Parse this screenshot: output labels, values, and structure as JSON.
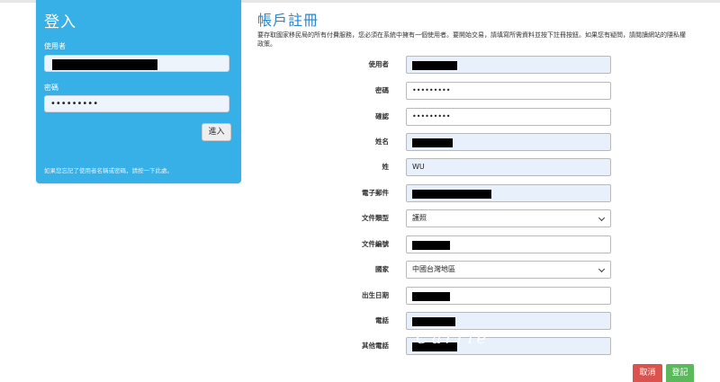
{
  "login": {
    "title": "登入",
    "username_label": "使用者",
    "password_label": "密碼",
    "password_value": "•••••••••",
    "submit_label": "進入",
    "forgot_note": "如果您忘記了使用者名稱或密碼，請按一下此處。"
  },
  "register": {
    "title": "帳戶註冊",
    "description": "要存取國家移民局的所有付費服務，您必須在系統中擁有一個使用者。要開始交易，請填寫所需資料並按下註冊按鈕。如果您有疑問，請閱讀網站的隱私權政策。",
    "fields": [
      {
        "label": "使用者",
        "value": ""
      },
      {
        "label": "密碼",
        "value": "•••••••••"
      },
      {
        "label": "確認",
        "value": "•••••••••"
      },
      {
        "label": "姓名",
        "value": ""
      },
      {
        "label": "姓",
        "value": "WU"
      },
      {
        "label": "電子郵件",
        "value": ""
      },
      {
        "label": "文件類型",
        "value": "護照"
      },
      {
        "label": "文件編號",
        "value": ""
      },
      {
        "label": "國家",
        "value": "中國台灣地區"
      },
      {
        "label": "出生日期",
        "value": ""
      },
      {
        "label": "電話",
        "value": ""
      },
      {
        "label": "其他電話",
        "value": ""
      }
    ],
    "cancel_label": "取消",
    "register_label": "登記"
  },
  "watermark": "Carrie",
  "colors": {
    "login_panel": "#36b0e6",
    "title_blue": "#2a86c9",
    "cancel": "#d9534f",
    "register": "#5cb85c",
    "autofill": "#e8f0fc"
  }
}
